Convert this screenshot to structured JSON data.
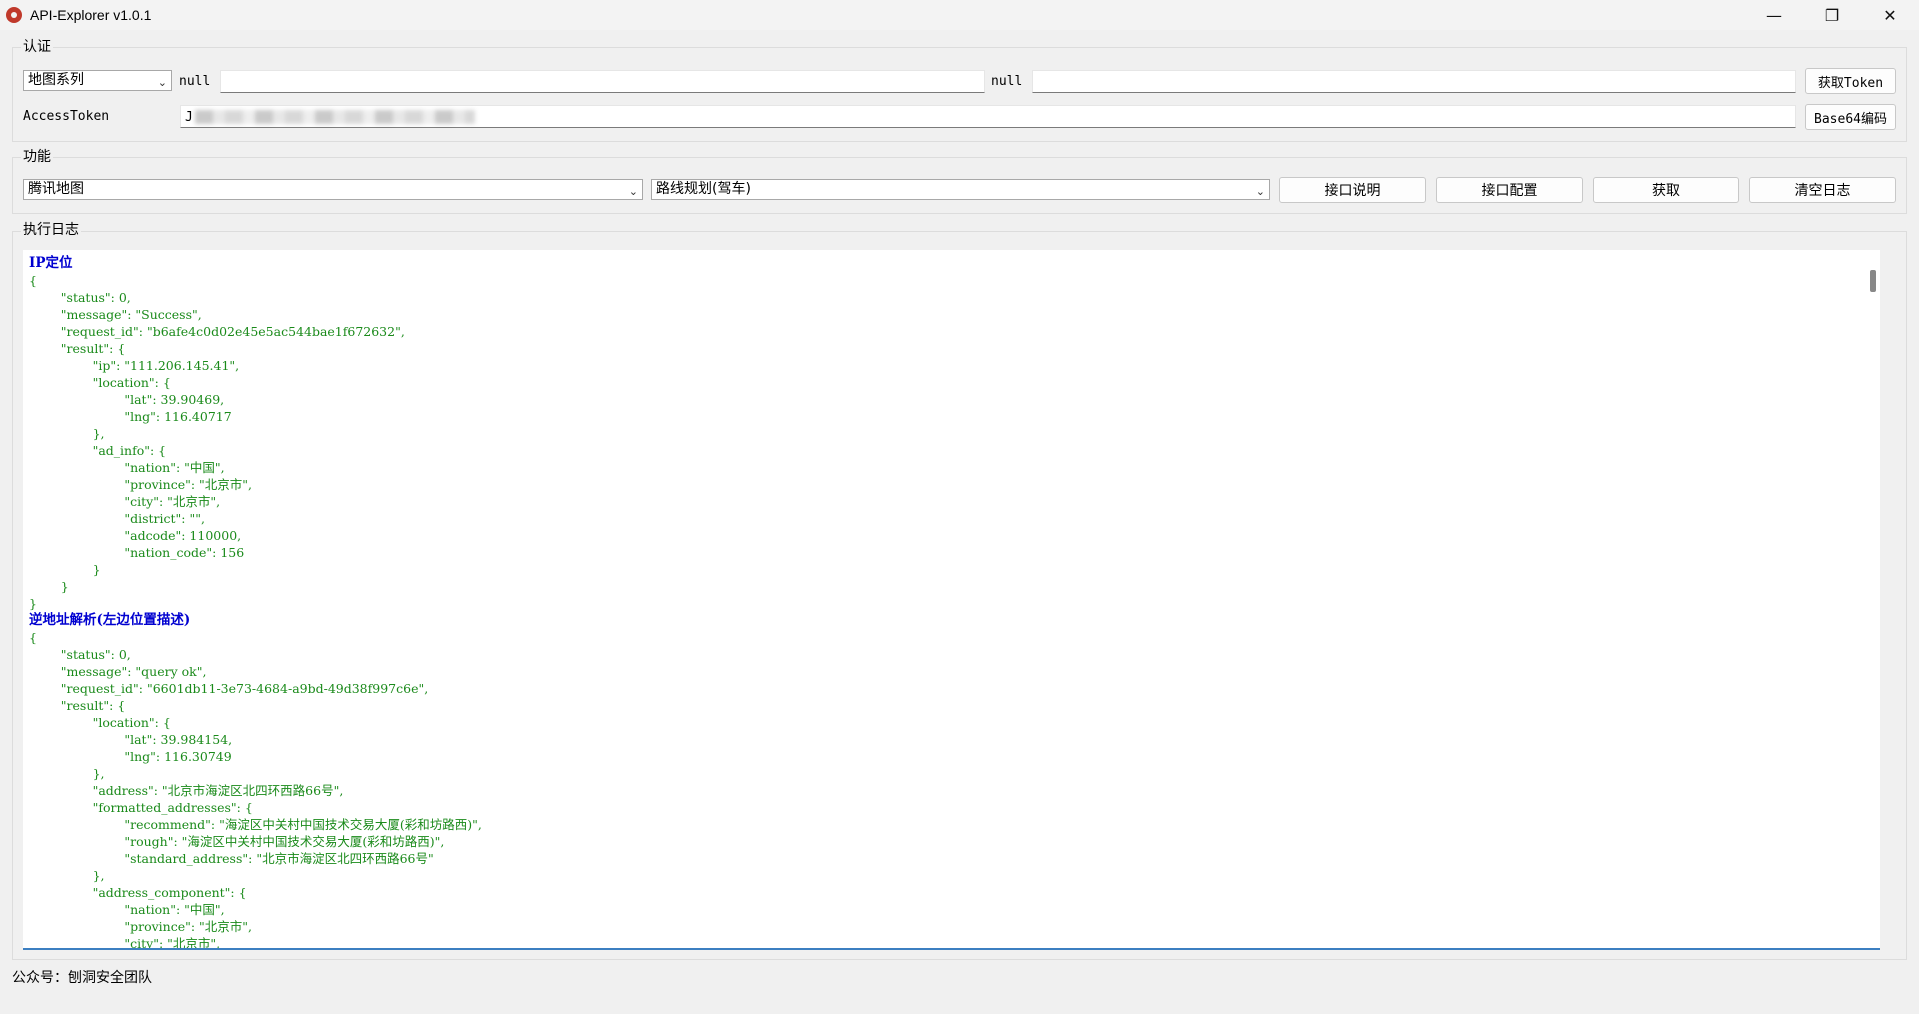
{
  "window": {
    "title": "API-Explorer v1.0.1",
    "minimize_glyph": "—",
    "restore_glyph": "❐",
    "close_glyph": "✕"
  },
  "auth": {
    "group_label": "认证",
    "series_select": "地图系列",
    "field1_label": "null",
    "field1_value": "",
    "field2_label": "null",
    "field2_value": "",
    "get_token_button": "获取Token",
    "access_token_label": "AccessToken",
    "access_token_prefix": "J",
    "base64_button": "Base64编码"
  },
  "function": {
    "group_label": "功能",
    "provider_select": "腾讯地图",
    "api_select": "路线规划(驾车)",
    "doc_button": "接口说明",
    "config_button": "接口配置",
    "fetch_button": "获取",
    "clear_button": "清空日志"
  },
  "log": {
    "group_label": "执行日志",
    "entries": [
      {
        "kind": "title",
        "text": "IP定位"
      },
      {
        "kind": "line",
        "text": "{"
      },
      {
        "kind": "line",
        "text": "        \"status\": 0,"
      },
      {
        "kind": "line",
        "text": "        \"message\": \"Success\","
      },
      {
        "kind": "line",
        "text": "        \"request_id\": \"b6afe4c0d02e45e5ac544bae1f672632\","
      },
      {
        "kind": "line",
        "text": "        \"result\": {"
      },
      {
        "kind": "line",
        "text": "                \"ip\": \"111.206.145.41\","
      },
      {
        "kind": "line",
        "text": "                \"location\": {"
      },
      {
        "kind": "line",
        "text": "                        \"lat\": 39.90469,"
      },
      {
        "kind": "line",
        "text": "                        \"lng\": 116.40717"
      },
      {
        "kind": "line",
        "text": "                },"
      },
      {
        "kind": "line",
        "text": "                \"ad_info\": {"
      },
      {
        "kind": "line",
        "text": "                        \"nation\": \"中国\","
      },
      {
        "kind": "line",
        "text": "                        \"province\": \"北京市\","
      },
      {
        "kind": "line",
        "text": "                        \"city\": \"北京市\","
      },
      {
        "kind": "line",
        "text": "                        \"district\": \"\","
      },
      {
        "kind": "line",
        "text": "                        \"adcode\": 110000,"
      },
      {
        "kind": "line",
        "text": "                        \"nation_code\": 156"
      },
      {
        "kind": "line",
        "text": "                }"
      },
      {
        "kind": "line",
        "text": "        }"
      },
      {
        "kind": "line",
        "text": "}"
      },
      {
        "kind": "title",
        "text": "逆地址解析(左边位置描述)"
      },
      {
        "kind": "line",
        "text": "{"
      },
      {
        "kind": "line",
        "text": "        \"status\": 0,"
      },
      {
        "kind": "line",
        "text": "        \"message\": \"query ok\","
      },
      {
        "kind": "line",
        "text": "        \"request_id\": \"6601db11-3e73-4684-a9bd-49d38f997c6e\","
      },
      {
        "kind": "line",
        "text": "        \"result\": {"
      },
      {
        "kind": "line",
        "text": "                \"location\": {"
      },
      {
        "kind": "line",
        "text": "                        \"lat\": 39.984154,"
      },
      {
        "kind": "line",
        "text": "                        \"lng\": 116.30749"
      },
      {
        "kind": "line",
        "text": "                },"
      },
      {
        "kind": "line",
        "text": "                \"address\": \"北京市海淀区北四环西路66号\","
      },
      {
        "kind": "line",
        "text": "                \"formatted_addresses\": {"
      },
      {
        "kind": "line",
        "text": "                        \"recommend\": \"海淀区中关村中国技术交易大厦(彩和坊路西)\","
      },
      {
        "kind": "line",
        "text": "                        \"rough\": \"海淀区中关村中国技术交易大厦(彩和坊路西)\","
      },
      {
        "kind": "line",
        "text": "                        \"standard_address\": \"北京市海淀区北四环西路66号\""
      },
      {
        "kind": "line",
        "text": "                },"
      },
      {
        "kind": "line",
        "text": "                \"address_component\": {"
      },
      {
        "kind": "line",
        "text": "                        \"nation\": \"中国\","
      },
      {
        "kind": "line",
        "text": "                        \"province\": \"北京市\","
      },
      {
        "kind": "line",
        "text": "                        \"city\": \"北京市\","
      }
    ]
  },
  "status_bar": {
    "text": "公众号：刨洞安全团队"
  }
}
